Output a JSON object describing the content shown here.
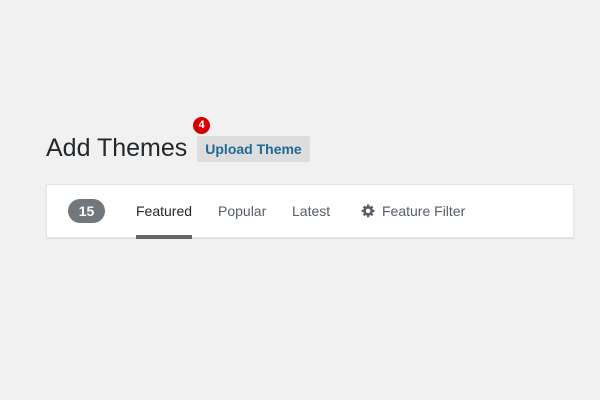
{
  "header": {
    "title": "Add Themes",
    "upload_label": "Upload Theme",
    "notification_count": "4"
  },
  "filter_bar": {
    "theme_count": "15",
    "tabs": [
      {
        "label": "Featured",
        "active": true
      },
      {
        "label": "Popular",
        "active": false
      },
      {
        "label": "Latest",
        "active": false
      }
    ],
    "feature_filter": {
      "label": "Feature Filter",
      "icon": "gear-icon"
    }
  },
  "colors": {
    "background": "#f1f1f1",
    "accent_link": "#1e6a94",
    "badge": "#d60000",
    "count_pill": "#72777c",
    "active_underline": "#666666"
  }
}
